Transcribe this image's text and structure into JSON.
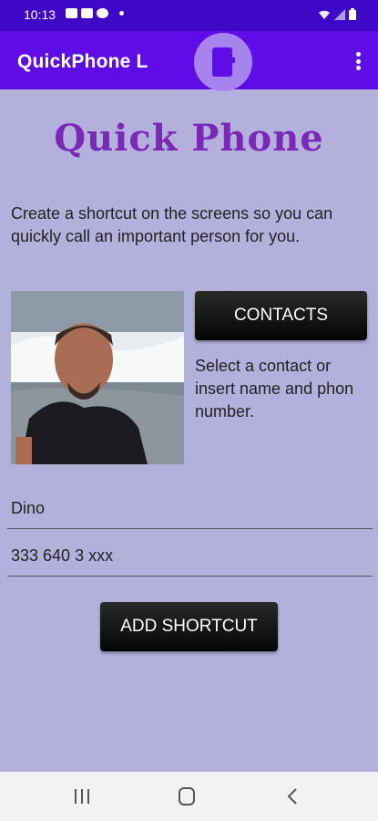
{
  "status_bar": {
    "time": "10:13",
    "left_icons": [
      "gallery-icon",
      "youtube-icon",
      "whatsapp-icon",
      "notification-dot-icon"
    ],
    "right_icons": [
      "wifi-icon",
      "signal-icon",
      "battery-icon"
    ]
  },
  "app_bar": {
    "title": "QuickPhone L",
    "center_icon": "phone-device-icon",
    "menu_icon": "overflow-menu-icon"
  },
  "logo": {
    "text": "Quick Phone",
    "color": "#7b28b8"
  },
  "description": "Create a shortcut on the screens so you can quickly call an important person for you.",
  "contacts_button": {
    "label": "CONTACTS"
  },
  "hint": "Select a contact or insert name and phon number.",
  "form": {
    "name_value": "Dino",
    "phone_value": "333 640 3 xxx"
  },
  "add_shortcut_button": {
    "label": "ADD SHORTCUT"
  },
  "nav_bar": {
    "buttons": [
      "recent-apps-icon",
      "home-icon",
      "back-icon"
    ]
  },
  "colors": {
    "status_bar": "#3f07c6",
    "app_bar": "#5f0de6",
    "background": "#b3b1dc",
    "button": "#111111"
  }
}
